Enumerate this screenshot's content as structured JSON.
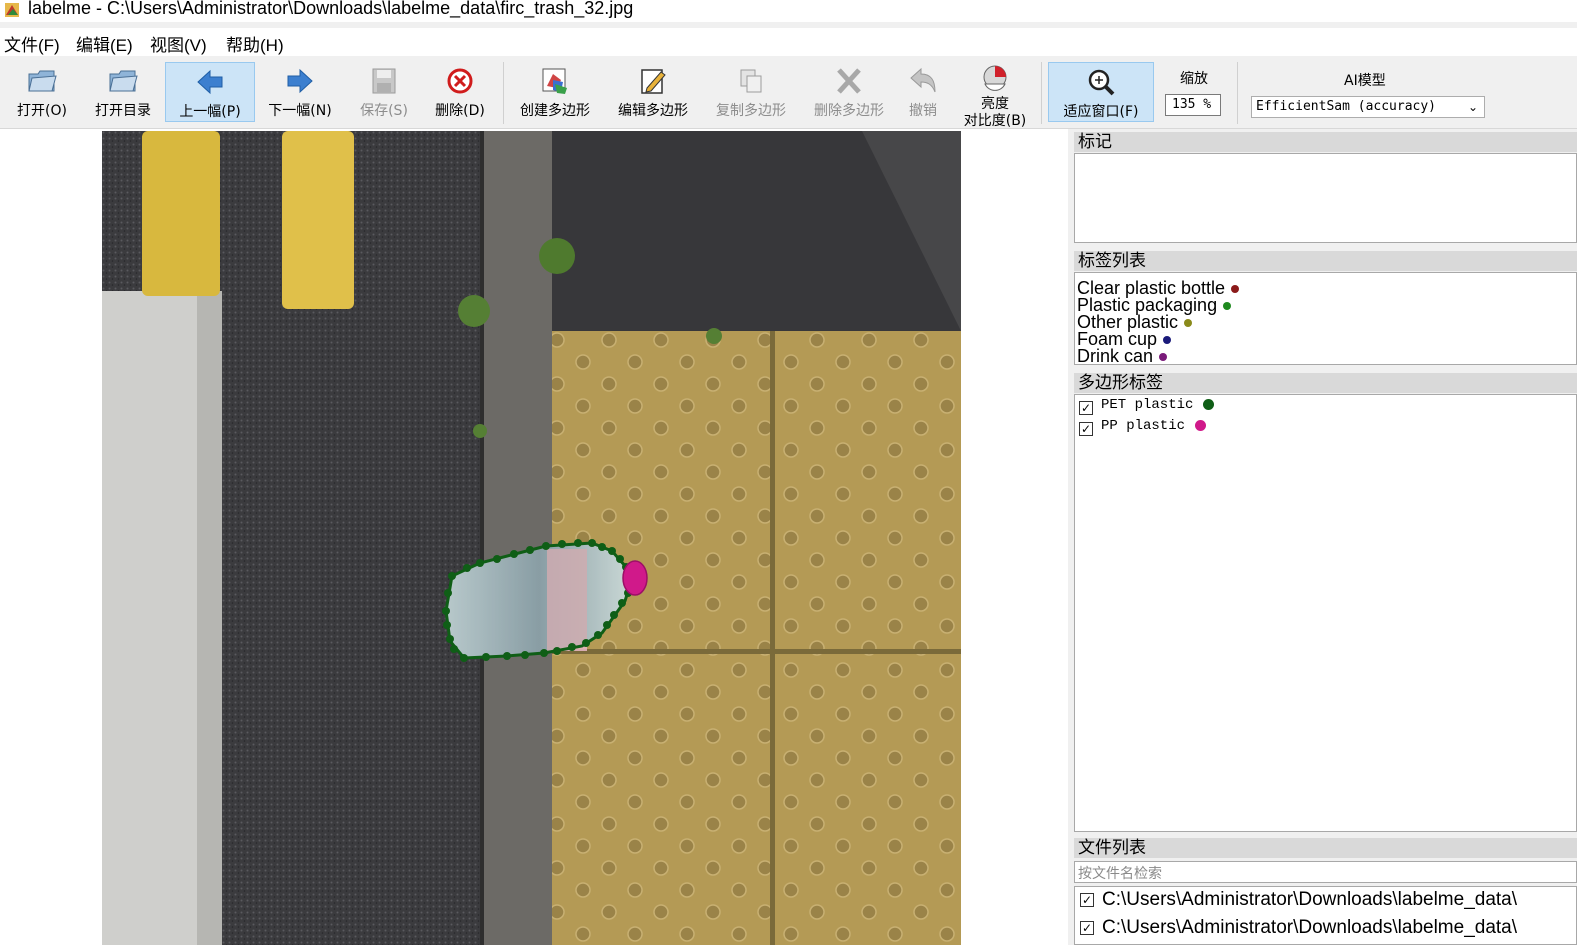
{
  "window": {
    "title": "labelme - C:\\Users\\Administrator\\Downloads\\labelme_data\\firc_trash_32.jpg"
  },
  "menu": [
    "文件(F)",
    "编辑(E)",
    "视图(V)",
    "帮助(H)"
  ],
  "toolbar": {
    "open": "打开(O)",
    "open_dir": "打开目录",
    "prev": "上一幅(P)",
    "next": "下一幅(N)",
    "save": "保存(S)",
    "delete": "删除(D)",
    "create_polygon": "创建多边形",
    "edit_polygon": "编辑多边形",
    "copy_polygon": "复制多边形",
    "delete_polygon": "删除多边形",
    "undo": "撤销",
    "brightness_line1": "亮度",
    "brightness_line2": "对比度(B)",
    "fit_window": "适应窗口(F)",
    "zoom_label": "缩放",
    "zoom_value": "135 %",
    "ai_label": "AI模型",
    "ai_model": "EfficientSam (accuracy)"
  },
  "panels": {
    "flags_title": "标记",
    "label_list_title": "标签列表",
    "polygon_labels_title": "多边形标签",
    "file_list_title": "文件列表",
    "file_search_placeholder": "按文件名检索"
  },
  "label_list": [
    {
      "name": "Clear plastic bottle",
      "color": "#8b1a1a"
    },
    {
      "name": "Plastic packaging",
      "color": "#1f8a1f"
    },
    {
      "name": "Other plastic",
      "color": "#8a8a1a"
    },
    {
      "name": "Foam cup",
      "color": "#1a1a7a"
    },
    {
      "name": "Drink can",
      "color": "#7a1a7a"
    }
  ],
  "polygon_labels": [
    {
      "name": "PET plastic",
      "color": "#0f5e16",
      "checked": true
    },
    {
      "name": "PP plastic",
      "color": "#d0198a",
      "checked": true
    }
  ],
  "file_list": [
    {
      "path": "C:\\Users\\Administrator\\Downloads\\labelme_data\\",
      "checked": true
    },
    {
      "path": "C:\\Users\\Administrator\\Downloads\\labelme_data\\",
      "checked": true
    }
  ],
  "colors": {
    "accent_active": "#cce4f7",
    "polygon_pet": "#0f5e16",
    "polygon_pp": "#d0198a"
  }
}
